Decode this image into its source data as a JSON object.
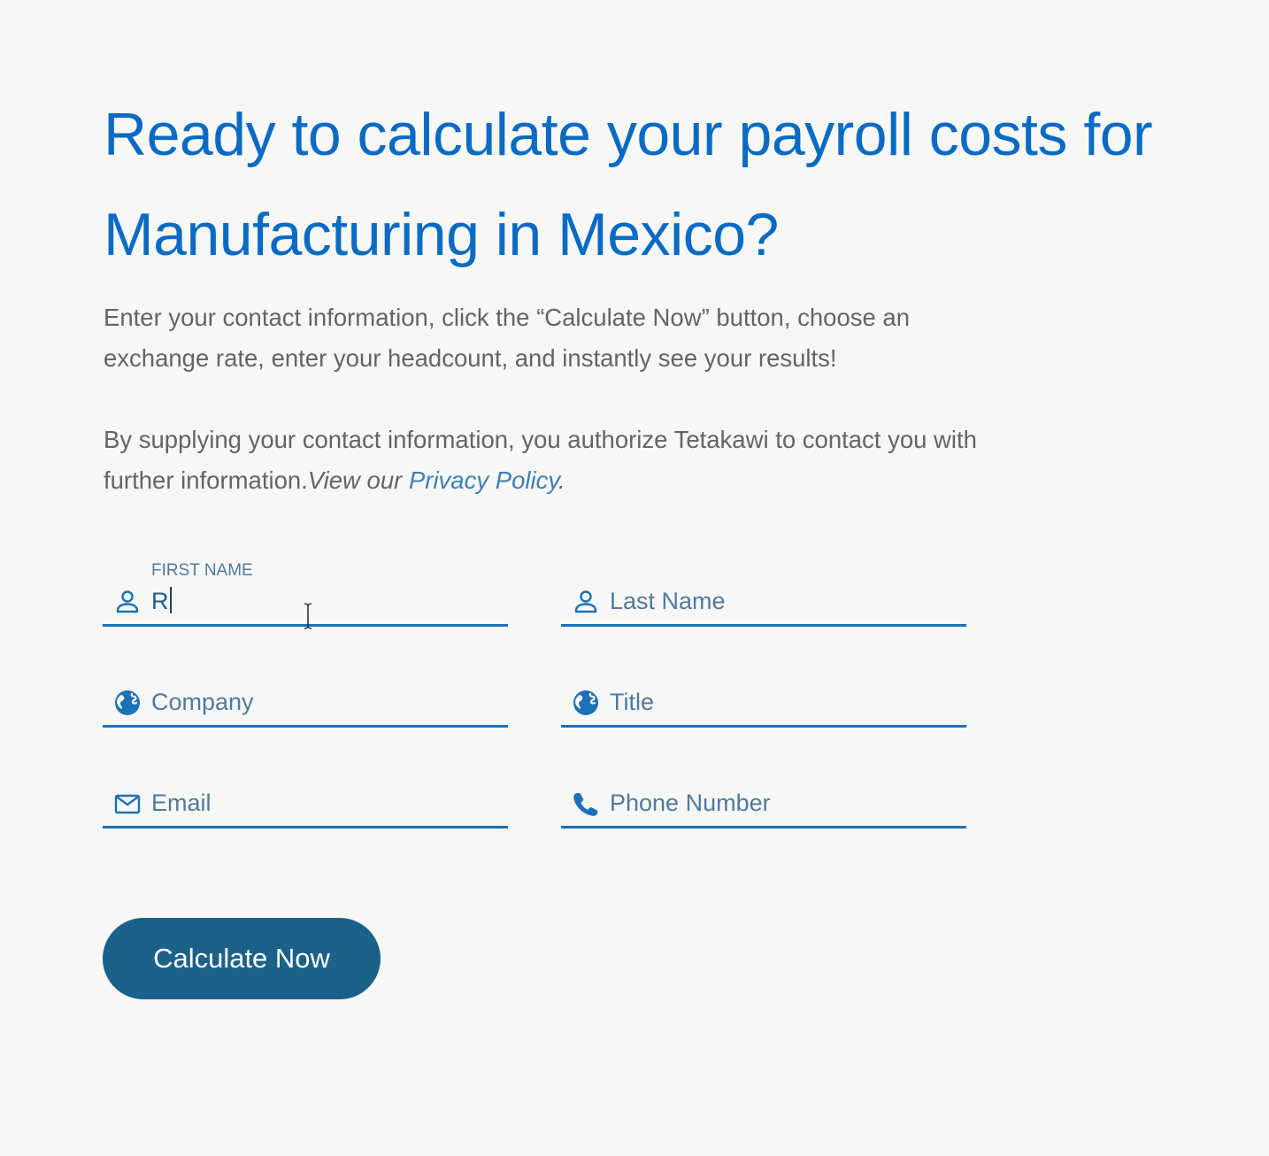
{
  "heading": {
    "line1": "Ready to calculate your payroll costs for",
    "line2": "Manufacturing in Mexico?"
  },
  "intro": {
    "line1": "Enter your contact information, click the “Calculate Now” button, choose an",
    "line2": "exchange rate, enter your headcount, and instantly see your results!"
  },
  "consent": {
    "line1": "By supplying your contact information, you authorize Tetakawi to contact you with",
    "line2_text": "further information.",
    "line2_italic": "View our ",
    "privacy_link": "Privacy Policy",
    "period": "."
  },
  "form": {
    "first_name": {
      "label": "FIRST NAME",
      "value": "R",
      "icon": "person-icon"
    },
    "last_name": {
      "placeholder": "Last Name",
      "icon": "person-icon"
    },
    "company": {
      "placeholder": "Company",
      "icon": "globe-icon"
    },
    "title": {
      "placeholder": "Title",
      "icon": "globe-icon"
    },
    "email": {
      "placeholder": "Email",
      "icon": "envelope-icon"
    },
    "phone": {
      "placeholder": "Phone Number",
      "icon": "phone-icon"
    }
  },
  "submit": {
    "label": "Calculate Now"
  },
  "colors": {
    "accent": "#0a6bc4",
    "field_line": "#1b70b8",
    "field_text": "#4f7a9e",
    "body_text": "#646464",
    "button_bg": "#1c6189",
    "page_bg": "#f7f7f6"
  }
}
